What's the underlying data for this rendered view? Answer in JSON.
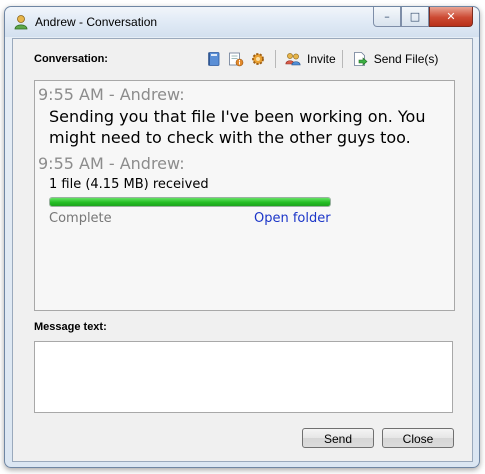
{
  "window": {
    "title": "Andrew - Conversation",
    "controls": {
      "minimize": "–",
      "maximize": "□",
      "close": "✕"
    }
  },
  "conversation": {
    "label": "Conversation:",
    "toolbar": {
      "invite_label": "Invite",
      "send_files_label": "Send File(s)",
      "icons": [
        "book-icon",
        "info-icon",
        "gear-icon",
        "users-icon",
        "send-file-icon"
      ]
    },
    "messages": [
      {
        "header": "9:55 AM - Andrew:",
        "text_lines": [
          "Sending you that file I've been working on. You",
          "might need to check with the other guys too."
        ]
      },
      {
        "header": "9:55 AM - Andrew:",
        "file_info": "1 file (4.15 MB) received",
        "progress": 1.0,
        "status": "Complete",
        "open_folder_label": "Open folder"
      }
    ]
  },
  "message_input": {
    "label": "Message text:",
    "value": ""
  },
  "buttons": {
    "send": "Send",
    "close": "Close"
  },
  "colors": {
    "progress": "#24be24",
    "link": "#1b35c8",
    "header_text": "#8c8c8c"
  }
}
